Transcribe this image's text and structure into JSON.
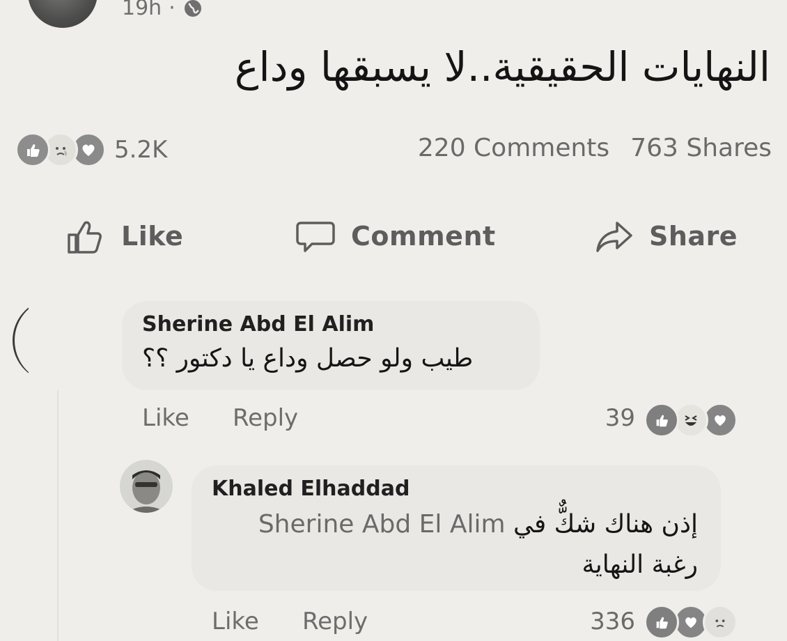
{
  "post": {
    "time": "19h",
    "separator": "·",
    "privacy_icon": "globe-icon",
    "text": "النهايات الحقيقية..لا يسبقها وداع"
  },
  "summary": {
    "reaction_icons": [
      "like-icon",
      "sad-icon",
      "love-icon"
    ],
    "reaction_count": "5.2K",
    "comments": "220 Comments",
    "shares": "763 Shares"
  },
  "actions": {
    "like": "Like",
    "comment": "Comment",
    "share": "Share"
  },
  "comments": [
    {
      "author": "Sherine Abd El Alim",
      "text": "طيب ولو حصل وداع يا دكتور ؟؟",
      "like": "Like",
      "reply": "Reply",
      "reaction_count": "39",
      "reaction_icons": [
        "like-icon",
        "haha-icon",
        "love-icon"
      ]
    },
    {
      "author": "Khaled Elhaddad",
      "mention": "Sherine Abd El Alim",
      "text_line1": "إذن هناك شكٌّ في",
      "text_line2": "رغبة النهاية",
      "like": "Like",
      "reply": "Reply",
      "reaction_count": "336",
      "reaction_icons": [
        "like-icon",
        "love-icon",
        "sad-icon"
      ]
    }
  ],
  "colors": {
    "background": "#efeeea",
    "bubble": "#e9e8e4",
    "muted_text": "#6a6a6a"
  }
}
